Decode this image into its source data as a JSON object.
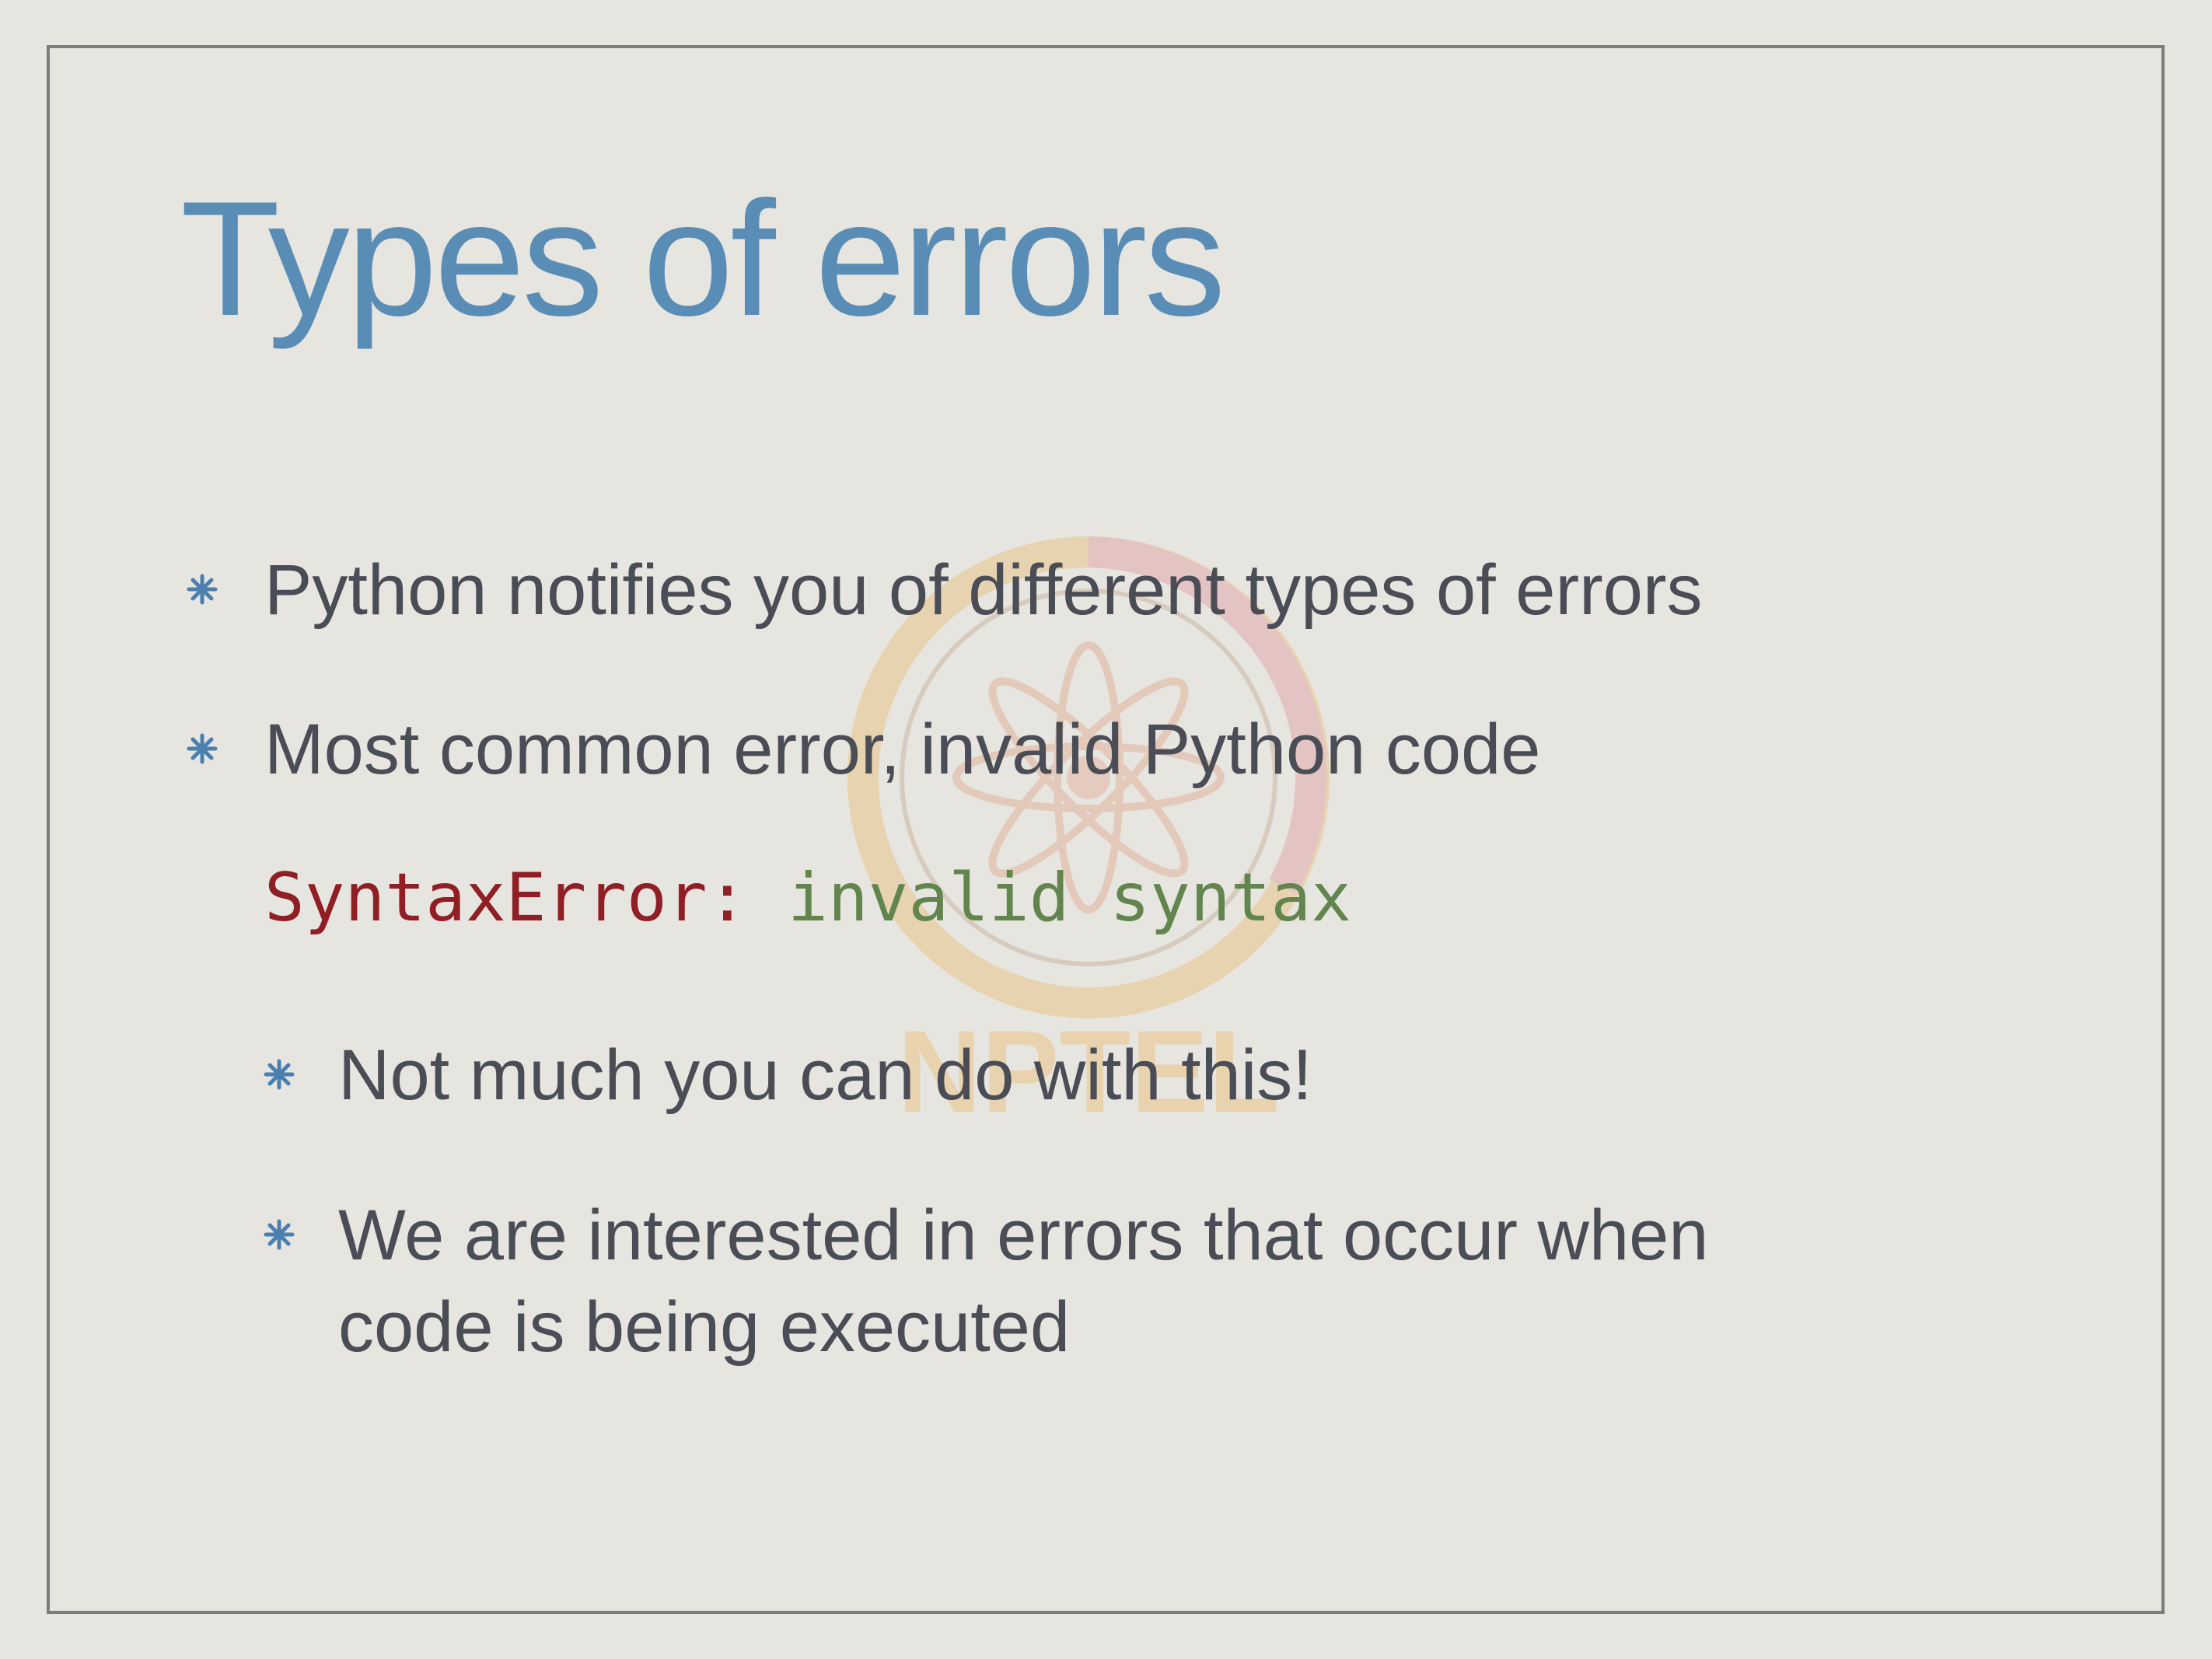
{
  "slide": {
    "title": "Types of errors",
    "bullets": [
      "Python notifies you of different types of errors",
      "Most common error, invalid Python code"
    ],
    "code": {
      "error_name": "SyntaxError:",
      "message": " invalid syntax"
    },
    "sub_bullets": [
      "Not much you can do with this!",
      "We are interested in errors that occur when",
      "code is being executed"
    ],
    "watermark_text": "NPTEL"
  },
  "colors": {
    "title": "#5a8db5",
    "body_text": "#4a4d55",
    "code_error": "#8f1f24",
    "code_message": "#61854d",
    "background": "#e6e5e0"
  },
  "icons": {
    "bullet": "asterisk-bullet-icon",
    "watermark": "nptel-logo"
  }
}
